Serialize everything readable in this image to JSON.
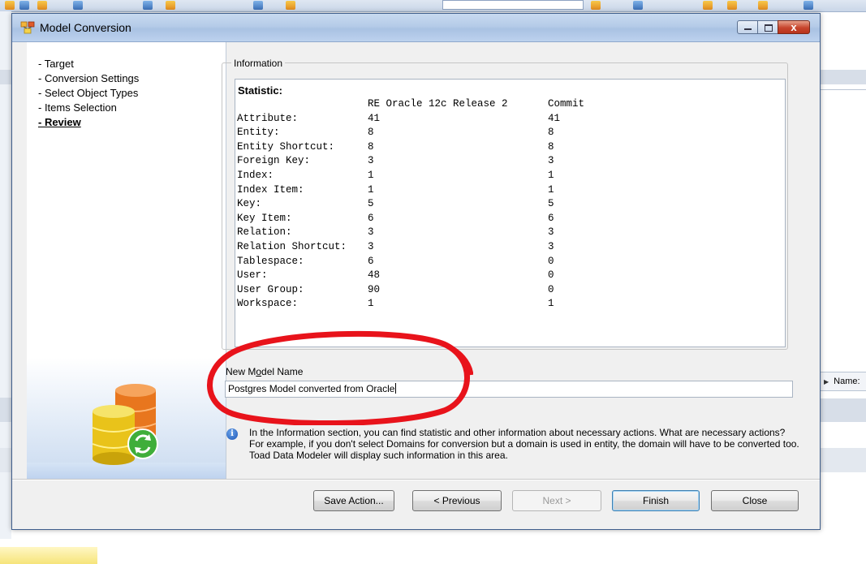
{
  "dialog": {
    "title": "Model Conversion",
    "close_glyph": "x"
  },
  "nav": {
    "items": [
      {
        "label": "- Target"
      },
      {
        "label": "- Conversion Settings"
      },
      {
        "label": "- Select Object Types"
      },
      {
        "label": "- Items Selection"
      },
      {
        "label": "- Review",
        "current": true
      }
    ]
  },
  "information": {
    "legend": "Information",
    "statistic_title": "Statistic:",
    "columns": [
      "",
      "RE Oracle 12c Release 2",
      "Commit"
    ],
    "rows": [
      [
        "Attribute:",
        "41",
        "41"
      ],
      [
        "Entity:",
        "8",
        "8"
      ],
      [
        "Entity Shortcut:",
        "8",
        "8"
      ],
      [
        "Foreign Key:",
        "3",
        "3"
      ],
      [
        "Index:",
        "1",
        "1"
      ],
      [
        "Index Item:",
        "1",
        "1"
      ],
      [
        "Key:",
        "5",
        "5"
      ],
      [
        "Key Item:",
        "6",
        "6"
      ],
      [
        "Relation:",
        "3",
        "3"
      ],
      [
        "Relation Shortcut:",
        "3",
        "3"
      ],
      [
        "Tablespace:",
        "6",
        "0"
      ],
      [
        "User:",
        "48",
        "0"
      ],
      [
        "User Group:",
        "90",
        "0"
      ],
      [
        "Workspace:",
        "1",
        "1"
      ]
    ]
  },
  "new_model": {
    "label": "New Model Name",
    "value": "Postgres Model converted from Oracle"
  },
  "help": {
    "icon_glyph": "i",
    "text": "In the Information section, you can find statistic and other information about necessary actions. What are necessary actions? For example, if you don't select Domains for conversion but a domain is used in entity, the domain will have to be converted too. Toad Data Modeler will display such information in this area."
  },
  "buttons": {
    "save_action": "Save Action...",
    "previous": "< Previous",
    "next": "Next >",
    "finish": "Finish",
    "close": "Close"
  },
  "background": {
    "names_label": "Name:"
  },
  "colors": {
    "annotation": "#e8131b",
    "titlebar": "#b5cbe8",
    "dialog_bg": "#f0f0f0"
  },
  "icons": {
    "app": "model-conversion-app-icon",
    "logo": "database-sync-logo",
    "help": "info-icon"
  }
}
